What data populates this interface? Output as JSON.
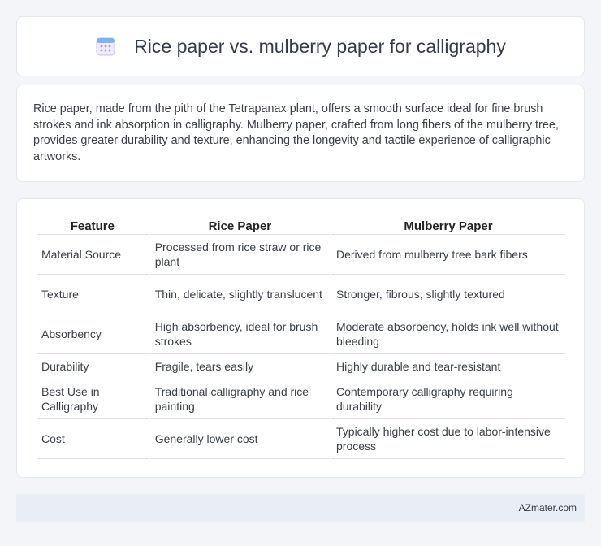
{
  "header": {
    "title": "Rice paper vs. mulberry paper for calligraphy",
    "icon": "calendar-icon"
  },
  "intro": {
    "text": "Rice paper, made from the pith of the Tetrapanax plant, offers a smooth surface ideal for fine brush strokes and ink absorption in calligraphy. Mulberry paper, crafted from long fibers of the mulberry tree, provides greater durability and texture, enhancing the longevity and tactile experience of calligraphic artworks."
  },
  "table": {
    "headers": [
      "Feature",
      "Rice Paper",
      "Mulberry Paper"
    ],
    "rows": [
      [
        "Material Source",
        "Processed from rice straw or rice plant",
        "Derived from mulberry tree bark fibers"
      ],
      [
        "Texture",
        "Thin, delicate, slightly translucent",
        "Stronger, fibrous, slightly textured"
      ],
      [
        "Absorbency",
        "High absorbency, ideal for brush strokes",
        "Moderate absorbency, holds ink well without bleeding"
      ],
      [
        "Durability",
        "Fragile, tears easily",
        "Highly durable and tear-resistant"
      ],
      [
        "Best Use in Calligraphy",
        "Traditional calligraphy and rice painting",
        "Contemporary calligraphy requiring durability"
      ],
      [
        "Cost",
        "Generally lower cost",
        "Typically higher cost due to labor-intensive process"
      ]
    ]
  },
  "footer": {
    "text": "AZmater.com"
  },
  "colors": {
    "background": "#f3f5f9",
    "card": "#ffffff",
    "footer": "#e8edf6",
    "icon_accent": "#8b7fd6"
  }
}
